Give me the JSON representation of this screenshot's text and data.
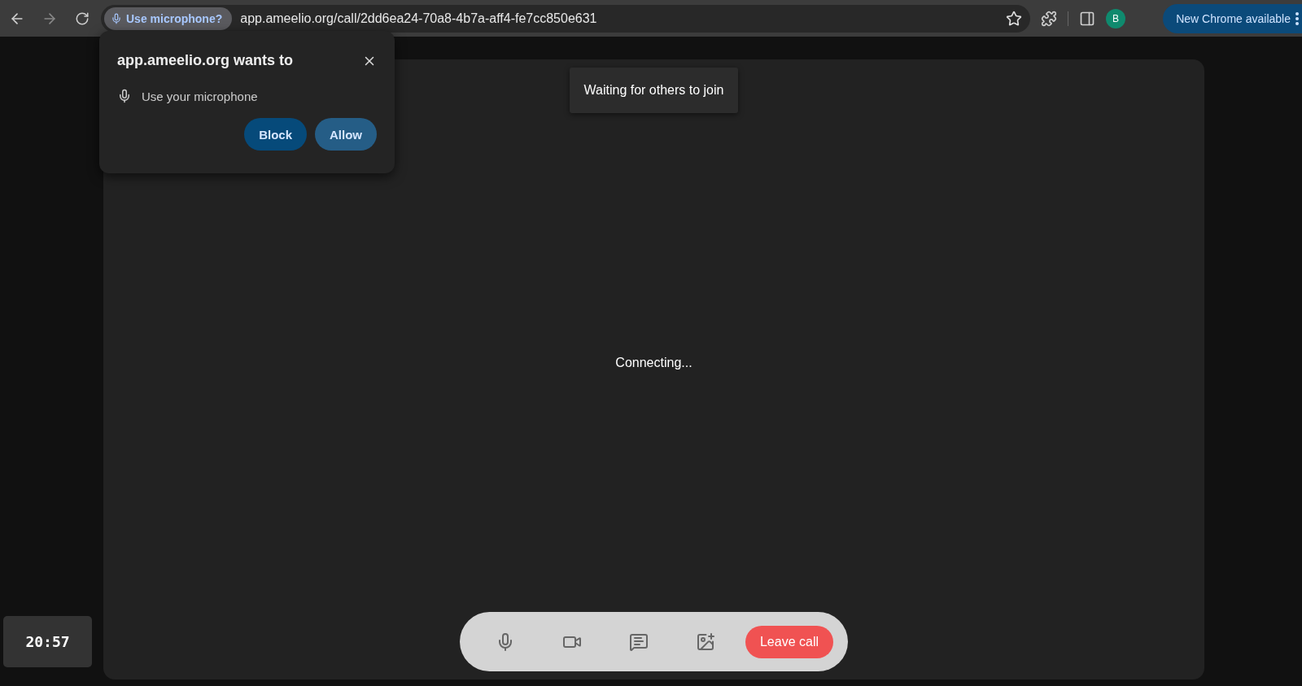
{
  "browser": {
    "permission_chip": "Use microphone?",
    "url": "app.ameelio.org/call/2dd6ea24-70a8-4b7a-aff4-fe7cc850e631",
    "profile_initial": "B",
    "update_button": "New Chrome available"
  },
  "permission_popup": {
    "title": "app.ameelio.org wants to",
    "request": "Use your microphone",
    "buttons": [
      {
        "label": "Block",
        "kind": "block"
      },
      {
        "label": "Allow",
        "kind": "allow"
      }
    ]
  },
  "call": {
    "toast": "Waiting for others to join",
    "status": "Connecting...",
    "controls": [
      {
        "kind": "mic"
      },
      {
        "kind": "camera"
      },
      {
        "kind": "chat"
      },
      {
        "kind": "screen"
      }
    ],
    "leave_button": "Leave call"
  },
  "timer": "20:57"
}
